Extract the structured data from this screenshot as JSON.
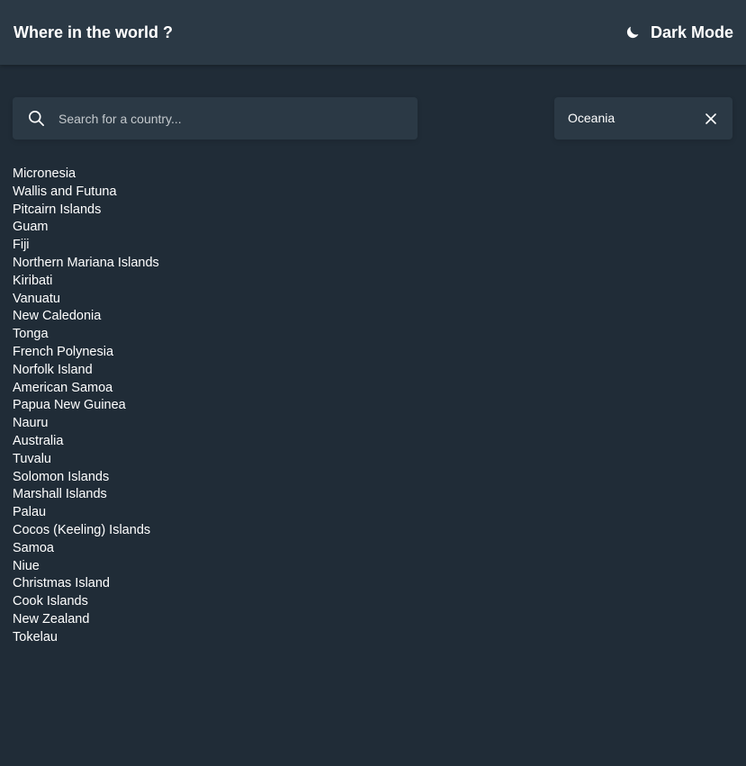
{
  "header": {
    "title": "Where in the world ?",
    "theme_toggle_label": "Dark Mode",
    "theme_icon": "moon-icon"
  },
  "search": {
    "placeholder": "Search for a country...",
    "value": "",
    "icon": "search-icon"
  },
  "filter": {
    "selected_region": "Oceania",
    "clear_icon": "close-icon"
  },
  "countries": [
    "Micronesia",
    "Wallis and Futuna",
    "Pitcairn Islands",
    "Guam",
    "Fiji",
    "Northern Mariana Islands",
    "Kiribati",
    "Vanuatu",
    "New Caledonia",
    "Tonga",
    "French Polynesia",
    "Norfolk Island",
    "American Samoa",
    "Papua New Guinea",
    "Nauru",
    "Australia",
    "Tuvalu",
    "Solomon Islands",
    "Marshall Islands",
    "Palau",
    "Cocos (Keeling) Islands",
    "Samoa",
    "Niue",
    "Christmas Island",
    "Cook Islands",
    "New Zealand",
    "Tokelau"
  ],
  "colors": {
    "background": "#202c37",
    "element": "#2b3945",
    "text": "#ffffff"
  }
}
